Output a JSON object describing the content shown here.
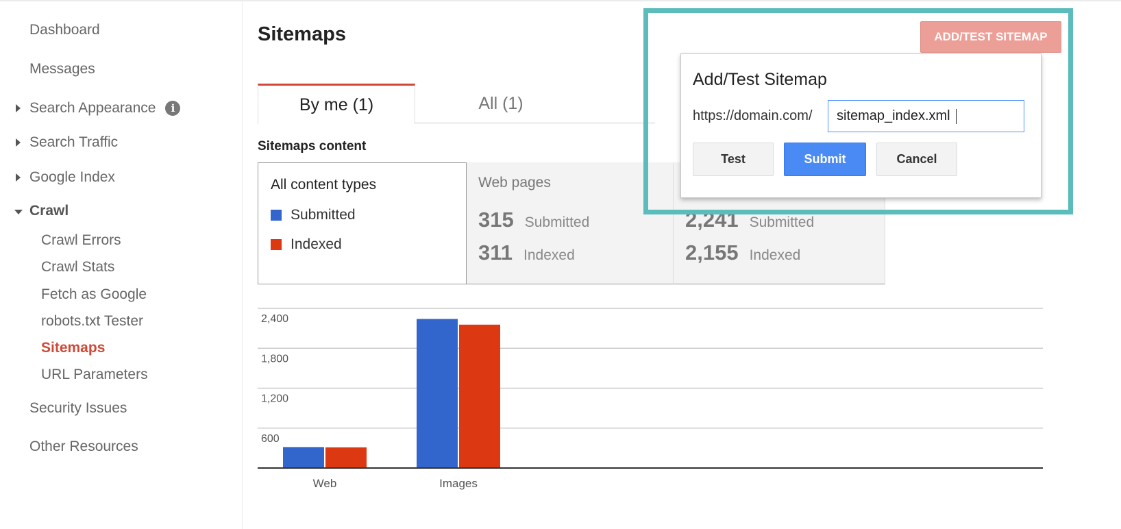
{
  "sidebar": {
    "items": [
      {
        "label": "Dashboard",
        "level": 0
      },
      {
        "label": "Messages",
        "level": 0
      },
      {
        "label": "Search Appearance",
        "level": 0,
        "expander": "collapsed",
        "icon": "info-icon"
      },
      {
        "label": "Search Traffic",
        "level": 0,
        "expander": "collapsed"
      },
      {
        "label": "Google Index",
        "level": 0,
        "expander": "collapsed"
      },
      {
        "label": "Crawl",
        "level": 0,
        "expander": "expanded"
      },
      {
        "label": "Crawl Errors",
        "level": 1
      },
      {
        "label": "Crawl Stats",
        "level": 1
      },
      {
        "label": "Fetch as Google",
        "level": 1
      },
      {
        "label": "robots.txt Tester",
        "level": 1
      },
      {
        "label": "Sitemaps",
        "level": 1,
        "active": true
      },
      {
        "label": "URL Parameters",
        "level": 1
      },
      {
        "label": "Security Issues",
        "level": 0
      },
      {
        "label": "Other Resources",
        "level": 0
      }
    ],
    "info_glyph": "i"
  },
  "header": {
    "title": "Sitemaps",
    "add_test_button": "ADD/TEST SITEMAP"
  },
  "tabs": [
    {
      "label": "By me (1)",
      "active": true
    },
    {
      "label": "All (1)",
      "active": false
    }
  ],
  "content": {
    "section_title": "Sitemaps content",
    "legend": {
      "title": "All content types",
      "items": [
        {
          "label": "Submitted",
          "color": "#3366cc"
        },
        {
          "label": "Indexed",
          "color": "#dc3912"
        }
      ]
    },
    "web": {
      "title": "Web pages",
      "submitted_value": "315",
      "submitted_label": "Submitted",
      "indexed_value": "311",
      "indexed_label": "Indexed"
    },
    "images": {
      "submitted_value": "2,241",
      "submitted_label": "Submitted",
      "indexed_value": "2,155",
      "indexed_label": "Indexed"
    }
  },
  "dialog": {
    "title": "Add/Test Sitemap",
    "url_prefix": "https://domain.com/",
    "input_value": "sitemap_index.xml",
    "buttons": {
      "test": "Test",
      "submit": "Submit",
      "cancel": "Cancel"
    }
  },
  "colors": {
    "accent_red": "#d14836",
    "highlight_frame": "#5bbcbc",
    "submit_blue": "#4a8af4",
    "add_button": "#ec9f97"
  },
  "chart_data": {
    "type": "bar",
    "categories": [
      "Web",
      "Images"
    ],
    "series": [
      {
        "name": "Submitted",
        "color": "#3366cc",
        "values": [
          315,
          2241
        ]
      },
      {
        "name": "Indexed",
        "color": "#dc3912",
        "values": [
          311,
          2155
        ]
      }
    ],
    "yticks": [
      600,
      1200,
      1800,
      2400
    ],
    "ytick_labels": [
      "600",
      "1,200",
      "1,800",
      "2,400"
    ],
    "ylim": [
      0,
      2400
    ],
    "title": "",
    "xlabel": "",
    "ylabel": "",
    "grid": true,
    "legend": "none"
  }
}
